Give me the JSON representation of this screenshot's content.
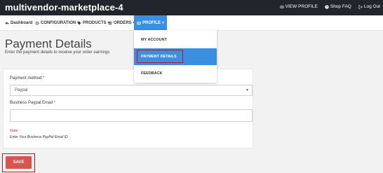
{
  "header": {
    "brand": "multivendor-marketplace-4",
    "links": [
      {
        "label": "VIEW PROFILE",
        "icon": "eye-icon"
      },
      {
        "label": "Shop FAQ",
        "icon": "question-icon"
      },
      {
        "label": "Log Out",
        "icon": "logout-icon"
      }
    ]
  },
  "nav": {
    "items": [
      {
        "label": "Dashboard",
        "icon": "dashboard-icon"
      },
      {
        "label": "CONFIGURATION",
        "icon": "gear-icon",
        "caret": "▾"
      },
      {
        "label": "PRODUCTS",
        "icon": "tag-icon",
        "caret": "▾"
      },
      {
        "label": "ORDERS",
        "icon": "list-icon",
        "caret": "▾"
      },
      {
        "label": "PROFILE",
        "icon": "profile-icon",
        "caret": "▾"
      }
    ]
  },
  "profile_menu": {
    "items": [
      "MY ACCOUNT",
      "PAYMENT DETAILS",
      "FEEDBACK"
    ],
    "active": "PAYMENT DETAILS"
  },
  "page": {
    "title": "Payment Details",
    "subtitle": "Enter the payment details to receive your order earnings"
  },
  "form": {
    "method_label": "Payment method",
    "method_value": "Paypal",
    "email_label": "Business Paypal Email",
    "required_mark": "*",
    "email_value": "",
    "note_label": "Note :",
    "note_text": "Enter Your Business PayPal Email ID",
    "save_label": "SAVE"
  },
  "colors": {
    "topbar": "#22252b",
    "accent": "#3b8fe0",
    "save_button": "#d9534f",
    "highlight_box": "#c8102e"
  }
}
